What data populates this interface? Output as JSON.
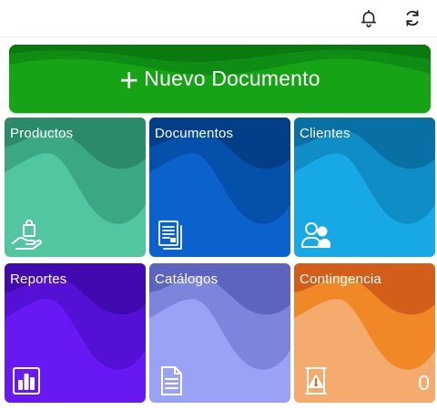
{
  "header": {
    "notifications_icon": "bell-icon",
    "sync_icon": "sync-icon"
  },
  "new_document": {
    "plus": "+",
    "label": "Nuevo Documento",
    "color": "#16a416"
  },
  "tiles": [
    {
      "label": "Productos",
      "icon": "hand-shopping-bag-icon",
      "colors": [
        "#52c6a0",
        "#3aa883",
        "#2b8a6a"
      ]
    },
    {
      "label": "Documentos",
      "icon": "documents-icon",
      "colors": [
        "#0b62cc",
        "#0550aa",
        "#033f88"
      ]
    },
    {
      "label": "Clientes",
      "icon": "users-icon",
      "colors": [
        "#17a9e6",
        "#0e8dc6",
        "#0870a2"
      ]
    },
    {
      "label": "Reportes",
      "icon": "bar-chart-icon",
      "colors": [
        "#6818f2",
        "#5510d6",
        "#400ab0"
      ]
    },
    {
      "label": "Catálogos",
      "icon": "document-icon",
      "colors": [
        "#9aa2f5",
        "#7c84db",
        "#5d64bd"
      ]
    },
    {
      "label": "Contingencia",
      "icon": "warning-document-icon",
      "colors": [
        "#f5aa6e",
        "#f08828",
        "#d25e1a"
      ],
      "count": "0"
    }
  ]
}
